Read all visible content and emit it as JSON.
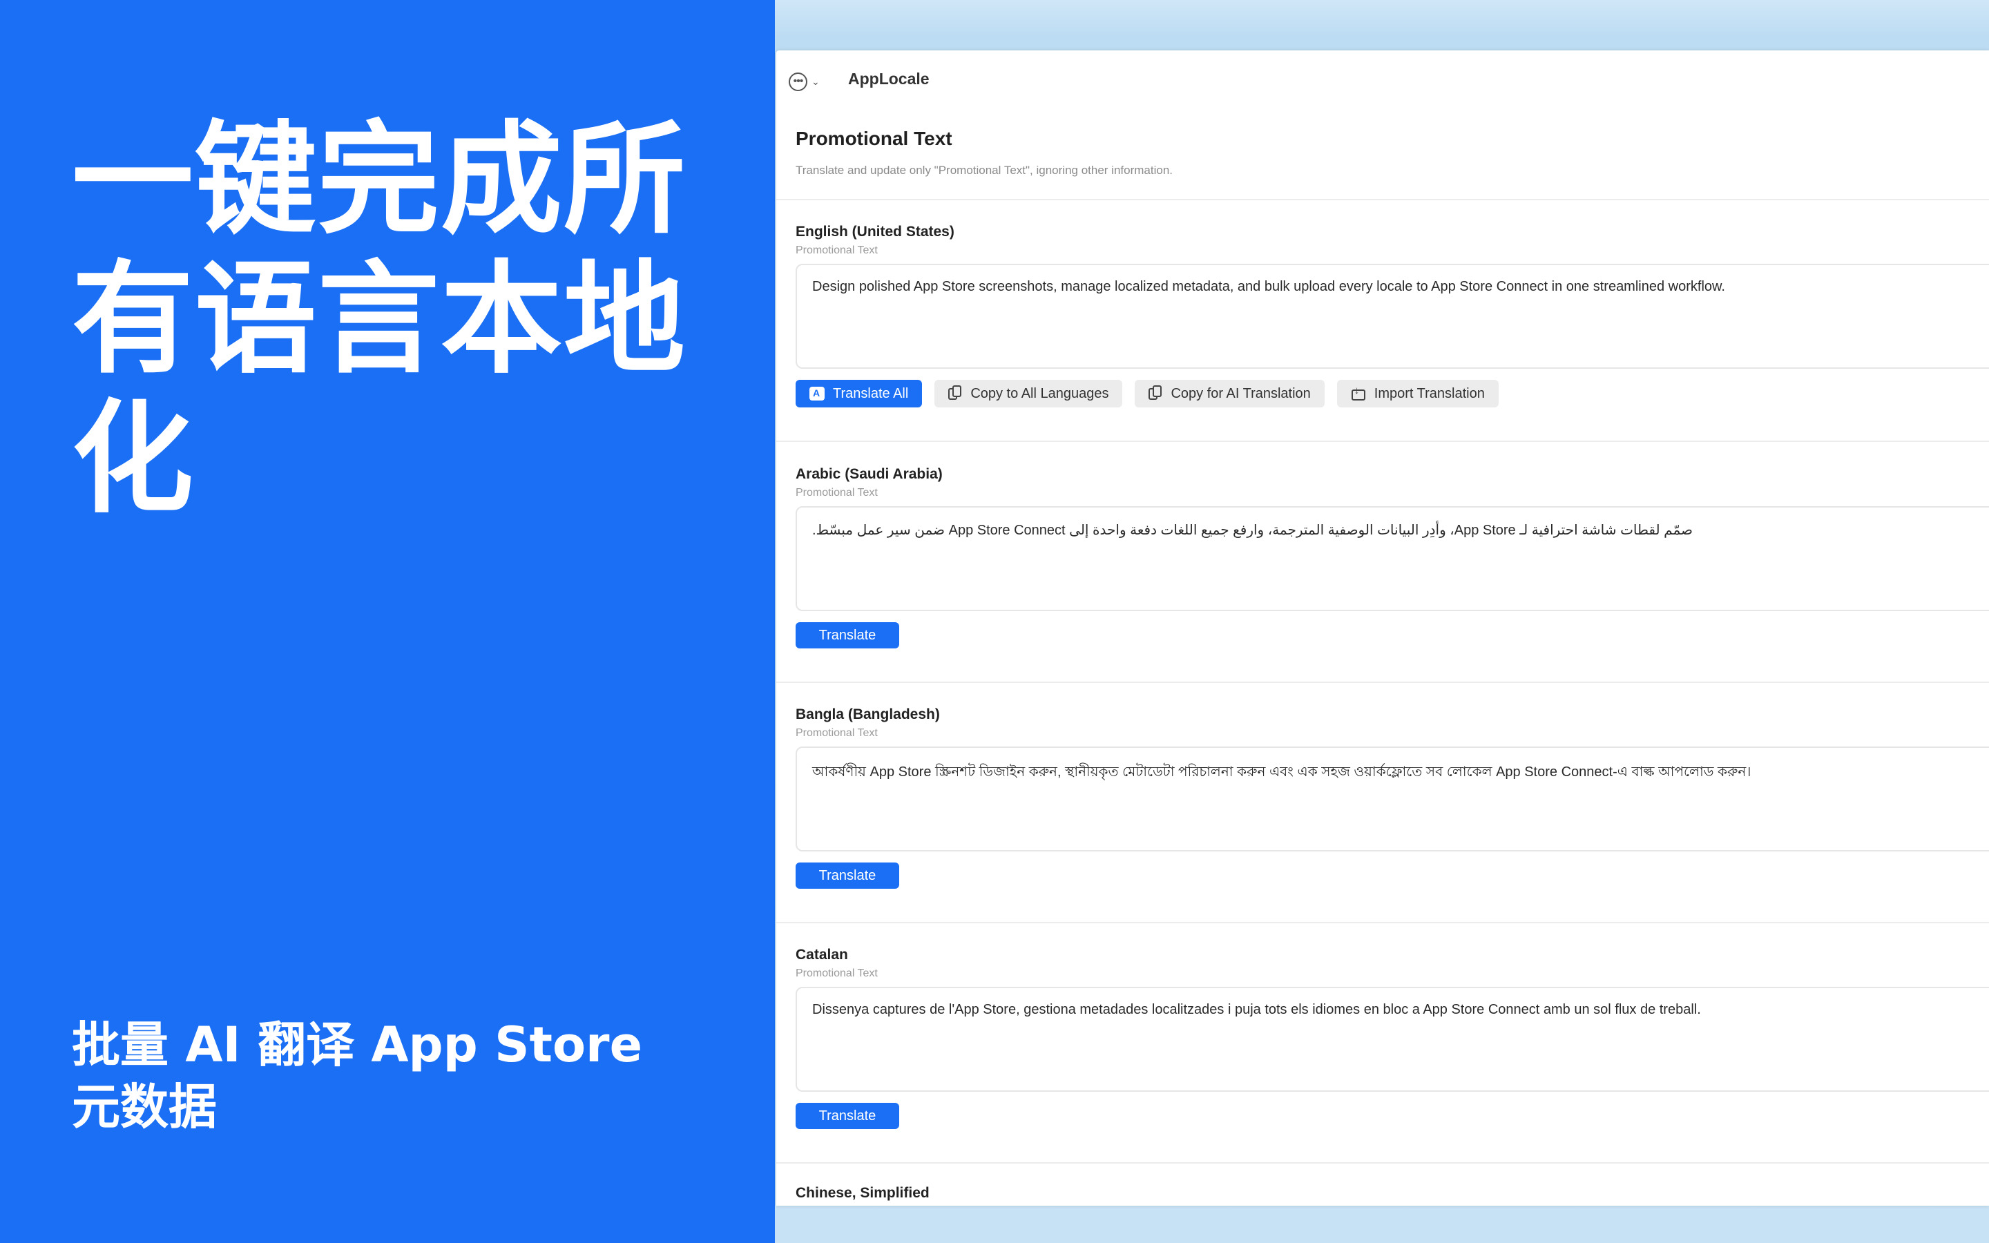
{
  "promo": {
    "headline": "一键完成所有语言本地化",
    "subline": "批量 AI 翻译 App Store 元数据"
  },
  "app": {
    "title": "AppLocale",
    "more_icon": "ellipsis-circle-icon"
  },
  "section": {
    "title": "Promotional Text",
    "description": "Translate and update only \"Promotional Text\", ignoring other information."
  },
  "locales": [
    {
      "name": "English (United States)",
      "field_label": "Promotional Text",
      "text": "Design polished App Store screenshots, manage localized metadata, and bulk upload every locale to App Store Connect in one streamlined workflow."
    },
    {
      "name": "Arabic (Saudi Arabia)",
      "field_label": "Promotional Text",
      "text": "صمّم لقطات شاشة احترافية لـ App Store، وأدِر البيانات الوصفية المترجمة، وارفع جميع اللغات دفعة واحدة إلى App Store Connect ضمن سير عمل مبسّط."
    },
    {
      "name": "Bangla (Bangladesh)",
      "field_label": "Promotional Text",
      "text": "আকর্ষণীয় App Store স্ক্রিনশট ডিজাইন করুন, স্থানীয়কৃত মেটাডেটা পরিচালনা করুন এবং এক সহজ ওয়ার্কফ্লোতে সব লোকেল App Store Connect-এ বাল্ক আপলোড করুন।"
    },
    {
      "name": "Catalan",
      "field_label": "Promotional Text",
      "text": "Dissenya captures de l'App Store, gestiona metadades localitzades i puja tots els idiomes en bloc a App Store Connect amb un sol flux de treball."
    },
    {
      "name": "Chinese, Simplified"
    }
  ],
  "buttons": {
    "translate_all": "Translate All",
    "copy_all": "Copy to All Languages",
    "copy_ai": "Copy for AI Translation",
    "import": "Import Translation",
    "translate": "Translate"
  },
  "colors": {
    "accent": "#1a6ff5",
    "window_bg": "#ffffff",
    "secondary_button": "#ececec"
  }
}
